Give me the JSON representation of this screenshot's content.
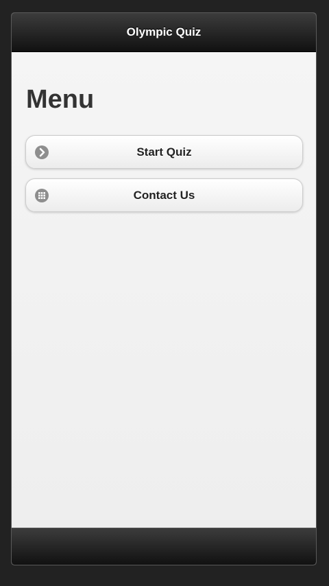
{
  "header": {
    "title": "Olympic Quiz"
  },
  "main": {
    "heading": "Menu",
    "buttons": [
      {
        "label": "Start Quiz",
        "icon": "arrow-right-icon"
      },
      {
        "label": "Contact Us",
        "icon": "grid-icon"
      }
    ]
  },
  "colors": {
    "bar": "#1a1a1a",
    "background": "#f0f0f0",
    "icon": "#8e8e8e"
  }
}
